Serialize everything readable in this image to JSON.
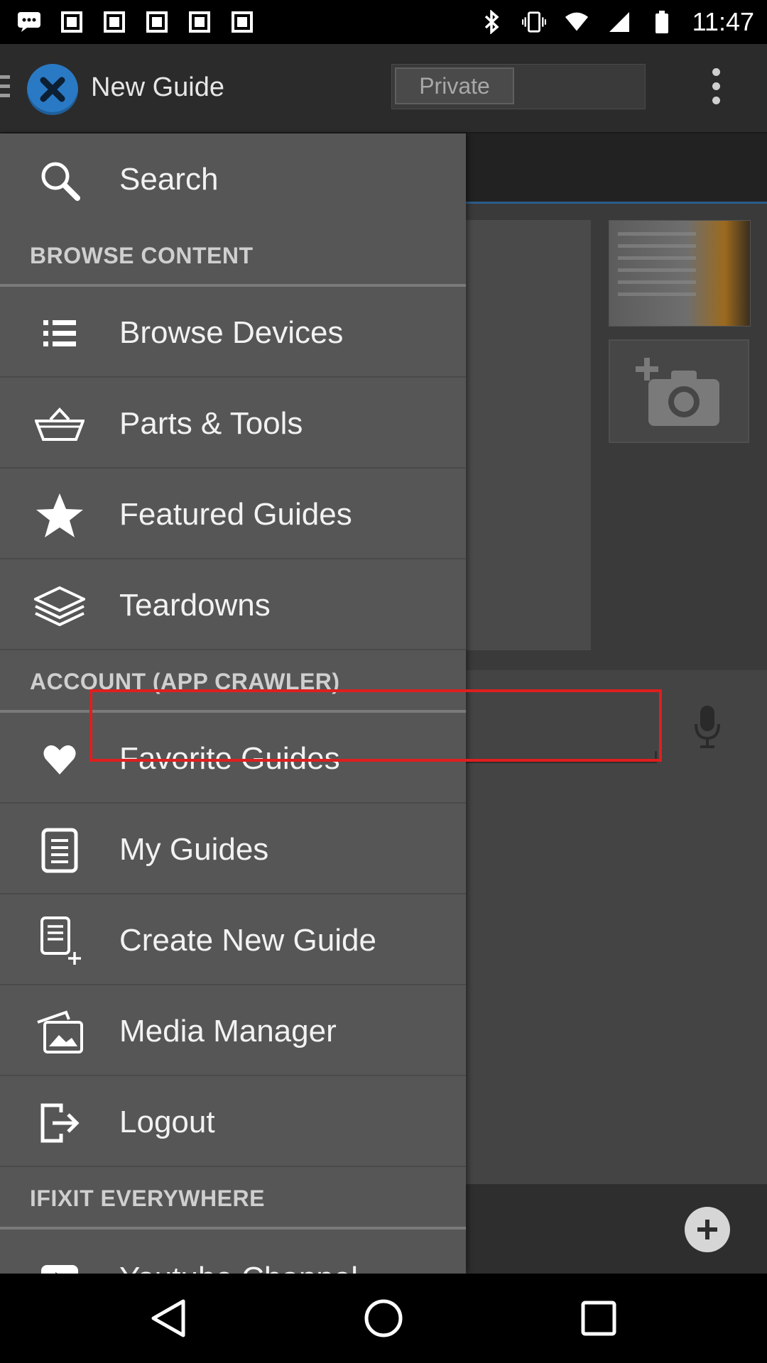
{
  "status_bar": {
    "time": "11:47",
    "left_icons": [
      "message-icon",
      "image-icon",
      "image-icon",
      "image-icon",
      "image-icon",
      "image-icon"
    ],
    "right_icons": [
      "bluetooth-icon",
      "vibrate-icon",
      "wifi-icon",
      "signal-icon",
      "battery-icon"
    ]
  },
  "action_bar": {
    "title": "New Guide",
    "private_label": "Private"
  },
  "drawer": {
    "search_label": "Search",
    "sections": [
      {
        "header": "BROWSE CONTENT",
        "items": [
          {
            "label": "Browse Devices",
            "icon": "list-icon"
          },
          {
            "label": "Parts & Tools",
            "icon": "basket-icon"
          },
          {
            "label": "Featured Guides",
            "icon": "star-icon"
          },
          {
            "label": "Teardowns",
            "icon": "layers-icon"
          }
        ]
      },
      {
        "header": "ACCOUNT (APP CRAWLER)",
        "items": [
          {
            "label": "Favorite Guides",
            "icon": "heart-icon"
          },
          {
            "label": "My Guides",
            "icon": "document-icon"
          },
          {
            "label": "Create New Guide",
            "icon": "document-add-icon"
          },
          {
            "label": "Media Manager",
            "icon": "media-icon"
          },
          {
            "label": "Logout",
            "icon": "logout-icon"
          }
        ]
      },
      {
        "header": "IFIXIT EVERYWHERE",
        "items": [
          {
            "label": "Youtube Channel",
            "icon": "youtube-icon"
          }
        ]
      }
    ]
  },
  "colors": {
    "drawer_bg": "#565656",
    "highlight": "#e01e1e",
    "logo_blue": "#2a79c4"
  }
}
